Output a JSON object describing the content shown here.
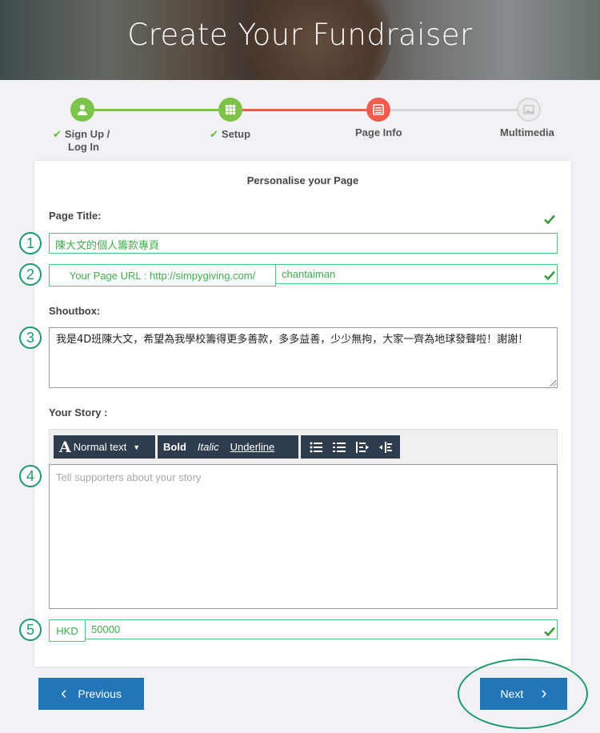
{
  "hero": {
    "title": "Create Your Fundraiser"
  },
  "steps": [
    {
      "label": "Sign Up / Log In",
      "line1": "Sign Up /",
      "line2": "Log In",
      "state": "done",
      "check": "✔"
    },
    {
      "label": "Setup",
      "state": "done",
      "check": "✔"
    },
    {
      "label": "Page Info",
      "state": "current"
    },
    {
      "label": "Multimedia",
      "state": "pending"
    }
  ],
  "colors": {
    "done": "#7dc34a",
    "current": "#ef5c4f",
    "pending": "#d6d6d6",
    "accent_green": "#4fc87a",
    "button_blue": "#2176b8",
    "annotation": "#1f9a69"
  },
  "form": {
    "heading": "Personalise your Page",
    "page_title_label": "Page Title:",
    "page_title_value": "陳大文的個人籌款專頁",
    "url_prefix": "Your Page URL : http://simpygiving.com/",
    "url_value": "chantaiman",
    "shoutbox_label": "Shoutbox:",
    "shoutbox_value": "我是4D班陳大文，希望為我學校籌得更多善款，多多益善，少少無拘，大家一齊為地球發聲啦！謝謝！",
    "story_label": "Your Story :",
    "story_placeholder": "Tell supporters about your story",
    "currency": "HKD",
    "target_amount": "50000"
  },
  "toolbar": {
    "font_icon": "A",
    "font_style": "Normal text",
    "bold": "Bold",
    "italic": "Italic",
    "underline": "Underline",
    "icons": [
      "bulleted-list-icon",
      "numbered-list-icon",
      "outdent-icon",
      "indent-icon"
    ]
  },
  "annotations": [
    "1",
    "2",
    "3",
    "4",
    "5"
  ],
  "nav": {
    "previous": "Previous",
    "next": "Next",
    "prev_icon": "‹",
    "next_icon": "›"
  }
}
